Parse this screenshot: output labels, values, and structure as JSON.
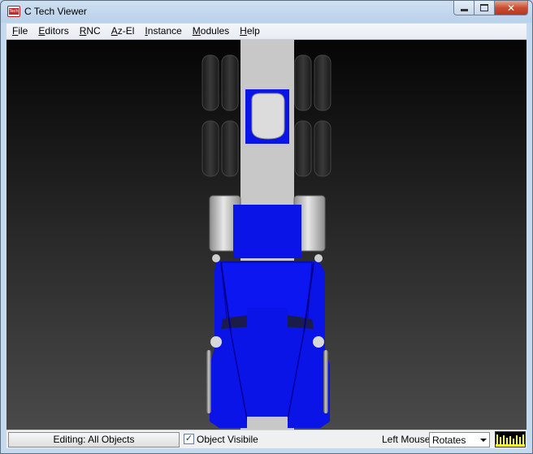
{
  "window": {
    "title": "C Tech Viewer",
    "icon_text": "Tech"
  },
  "menu": {
    "items": [
      {
        "first": "F",
        "rest": "ile"
      },
      {
        "first": "E",
        "rest": "ditors"
      },
      {
        "first": "R",
        "rest": "NC"
      },
      {
        "first": "A",
        "rest": "z-El"
      },
      {
        "first": "I",
        "rest": "nstance"
      },
      {
        "first": "M",
        "rest": "odules"
      },
      {
        "first": "H",
        "rest": "elp"
      }
    ]
  },
  "status": {
    "editing_label": "Editing: All Objects",
    "object_visible_label": "Object Visibile",
    "object_visible_checked": true,
    "left_mouse_label": "Left Mouse",
    "left_mouse_value": "Rotates"
  },
  "icons": {
    "app": "c-tech-logo-icon",
    "minimize": "minimize-icon",
    "maximize": "maximize-icon",
    "close": "close-icon",
    "checkbox": "checkmark-icon",
    "dropdown": "chevron-down-icon",
    "meter": "level-meter-icon"
  },
  "colors": {
    "model_body": "#0a14e6",
    "model_frame": "#c8c8c8",
    "meter_bars": "#ffff00",
    "background_top": "#050505",
    "background_bottom": "#4a4a4a"
  }
}
